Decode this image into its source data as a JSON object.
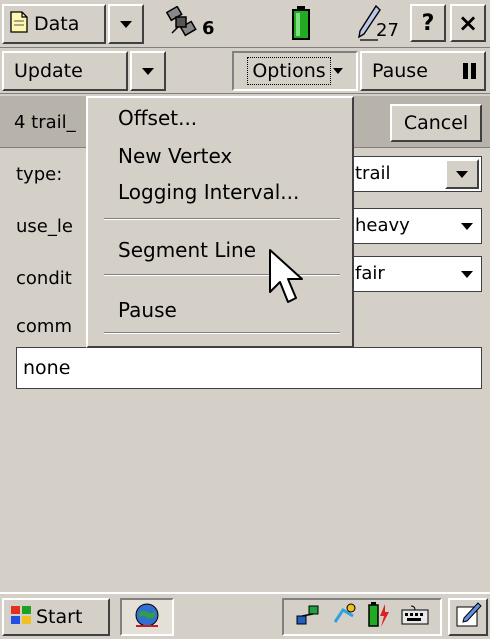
{
  "topbar": {
    "data_button_label": "Data",
    "satellite_count": "6",
    "pen_count": "27",
    "help_label": "?",
    "close_label": "×"
  },
  "toolbar": {
    "update_label": "Update",
    "options_label": "Options",
    "pause_label": "Pause"
  },
  "form": {
    "feature_label": "4 trail_",
    "cancel_label": "Cancel",
    "fields": [
      {
        "label": "type:",
        "value": "trail"
      },
      {
        "label": "use_le",
        "value": "heavy"
      },
      {
        "label": "condit",
        "value": "fair"
      },
      {
        "label": "comm"
      }
    ],
    "comment_value": "none"
  },
  "menu": {
    "items": [
      "Offset...",
      "New Vertex",
      "Logging Interval...",
      "Segment Line",
      "Pause"
    ]
  },
  "taskbar": {
    "start_label": "Start"
  },
  "colors": {
    "face": "#d4d0c8",
    "header_strip": "#b7b3ab",
    "battery_green": "#22aa22"
  }
}
